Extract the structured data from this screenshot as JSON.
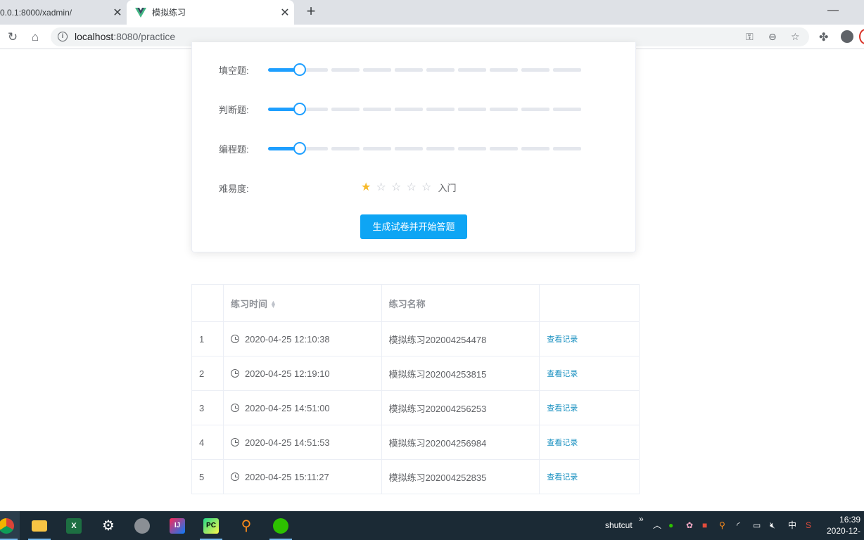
{
  "browser": {
    "tabs": [
      {
        "title": "0.0.1:8000/xadmin/",
        "active": false
      },
      {
        "title": "模拟练习",
        "active": true
      }
    ],
    "url_host": "localhost",
    "url_rest": ":8080/practice"
  },
  "form": {
    "rows": [
      {
        "label": "填空题:",
        "value": 1
      },
      {
        "label": "判断题:",
        "value": 1
      },
      {
        "label": "编程题:",
        "value": 1
      }
    ],
    "difficulty_label": "难易度:",
    "difficulty_rating": 1,
    "difficulty_max": 5,
    "difficulty_text": "入门",
    "submit_label": "生成试卷并开始答题"
  },
  "table": {
    "headers": [
      "",
      "练习时间",
      "练习名称",
      ""
    ],
    "rows": [
      {
        "index": "1",
        "time": "2020-04-25 12:10:38",
        "name": "模拟练习202004254478",
        "action": "查看记录"
      },
      {
        "index": "2",
        "time": "2020-04-25 12:19:10",
        "name": "模拟练习202004253815",
        "action": "查看记录"
      },
      {
        "index": "3",
        "time": "2020-04-25 14:51:00",
        "name": "模拟练习202004256253",
        "action": "查看记录"
      },
      {
        "index": "4",
        "time": "2020-04-25 14:51:53",
        "name": "模拟练习202004256984",
        "action": "查看记录"
      },
      {
        "index": "5",
        "time": "2020-04-25 15:11:27",
        "name": "模拟练习202004252835",
        "action": "查看记录"
      }
    ]
  },
  "taskbar": {
    "tray_label": "shutcut",
    "ime": "中",
    "time": "16:39",
    "date": "2020-12-"
  },
  "colors": {
    "accent": "#1e9fff",
    "button": "#0ea5f4",
    "star_on": "#f7ba2a",
    "link": "#1890c0",
    "taskbar": "#1b2a35"
  }
}
